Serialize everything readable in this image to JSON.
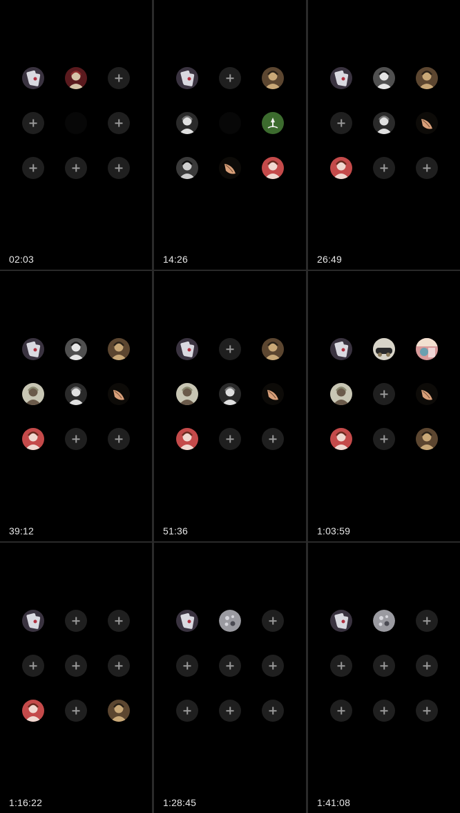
{
  "panels": [
    {
      "time": "02:03",
      "seats": [
        "av-cards",
        "av-maroon",
        "empty",
        "empty",
        "locked",
        "empty",
        "empty",
        "empty",
        "empty"
      ]
    },
    {
      "time": "14:26",
      "seats": [
        "av-cards",
        "empty",
        "av-bronze",
        "av-bw-hat",
        "locked",
        "av-green-emblem",
        "av-bw-man",
        "av-hand-feather",
        "av-red-shemagh"
      ]
    },
    {
      "time": "26:49",
      "seats": [
        "av-cards",
        "av-bw-face",
        "av-bronze",
        "empty",
        "av-bw-hat",
        "av-hand-feather",
        "av-red-shemagh",
        "empty",
        "empty"
      ]
    },
    {
      "time": "39:12",
      "seats": [
        "av-cards",
        "av-bw-face",
        "av-bronze",
        "av-light-figure",
        "av-bw-hat",
        "av-hand-feather",
        "av-red-shemagh",
        "empty",
        "empty"
      ]
    },
    {
      "time": "51:36",
      "seats": [
        "av-cards",
        "empty",
        "av-bronze",
        "av-light-figure",
        "av-bw-hat",
        "av-hand-feather",
        "av-red-shemagh",
        "empty",
        "empty"
      ]
    },
    {
      "time": "1:03:59",
      "seats": [
        "av-cards",
        "av-car",
        "av-pink-scene",
        "av-light-figure",
        "empty",
        "av-hand-feather",
        "av-red-shemagh",
        "empty",
        "av-bronze"
      ]
    },
    {
      "time": "1:16:22",
      "seats": [
        "av-cards",
        "empty",
        "empty",
        "empty",
        "empty",
        "empty",
        "av-red-shemagh",
        "empty",
        "av-bronze"
      ]
    },
    {
      "time": "1:28:45",
      "seats": [
        "av-cards",
        "av-silver-orb",
        "empty",
        "empty",
        "empty",
        "empty",
        "empty",
        "empty",
        "empty"
      ]
    },
    {
      "time": "1:41:08",
      "seats": [
        "av-cards",
        "av-silver-orb",
        "empty",
        "empty",
        "empty",
        "empty",
        "empty",
        "empty",
        "empty"
      ]
    }
  ],
  "avatars": {
    "av-cards": {
      "icon": "playing-cards-avatar-icon",
      "bg": "#3a3340",
      "fg": "#d9d9e0",
      "accent": "#b03040"
    },
    "av-maroon": {
      "icon": "maroon-portrait-avatar-icon",
      "bg": "#5a1a1e",
      "fg": "#d6c4a8",
      "accent": "#8c2c2c"
    },
    "av-bronze": {
      "icon": "bronze-portrait-avatar-icon",
      "bg": "#5c4630",
      "fg": "#c9a877",
      "accent": "#2b2218"
    },
    "av-bw-hat": {
      "icon": "bw-portrait-avatar-icon",
      "bg": "#2a2a2a",
      "fg": "#e0e0e0",
      "accent": "#777777"
    },
    "av-green-emblem": {
      "icon": "green-emblem-avatar-icon",
      "bg": "#3c6b2e",
      "fg": "#f2f2f2",
      "accent": "#2c5222"
    },
    "av-bw-man": {
      "icon": "bw-man-avatar-icon",
      "bg": "#3a3a3a",
      "fg": "#cfcfcf",
      "accent": "#111111"
    },
    "av-hand-feather": {
      "icon": "hand-feather-avatar-icon",
      "bg": "#0d0b08",
      "fg": "#d9a07a",
      "accent": "#6b4a32"
    },
    "av-red-shemagh": {
      "icon": "red-shemagh-avatar-icon",
      "bg": "#c44a4a",
      "fg": "#f0d8d0",
      "accent": "#6a2a20"
    },
    "av-bw-face": {
      "icon": "bw-face-avatar-icon",
      "bg": "#505050",
      "fg": "#e6e6e6",
      "accent": "#1c1c1c"
    },
    "av-light-figure": {
      "icon": "light-figure-avatar-icon",
      "bg": "#c8c6b4",
      "fg": "#6a5a4a",
      "accent": "#8a8a70"
    },
    "av-car": {
      "icon": "car-avatar-icon",
      "bg": "#d8d4c8",
      "fg": "#2a2a2a",
      "accent": "#8a7a5a"
    },
    "av-pink-scene": {
      "icon": "pink-scene-avatar-icon",
      "bg": "#d89a9a",
      "fg": "#6aa0b0",
      "accent": "#f2e0d0"
    },
    "av-silver-orb": {
      "icon": "silver-orb-avatar-icon",
      "bg": "#9a9aa0",
      "fg": "#d6d6dc",
      "accent": "#4a4a52"
    }
  }
}
